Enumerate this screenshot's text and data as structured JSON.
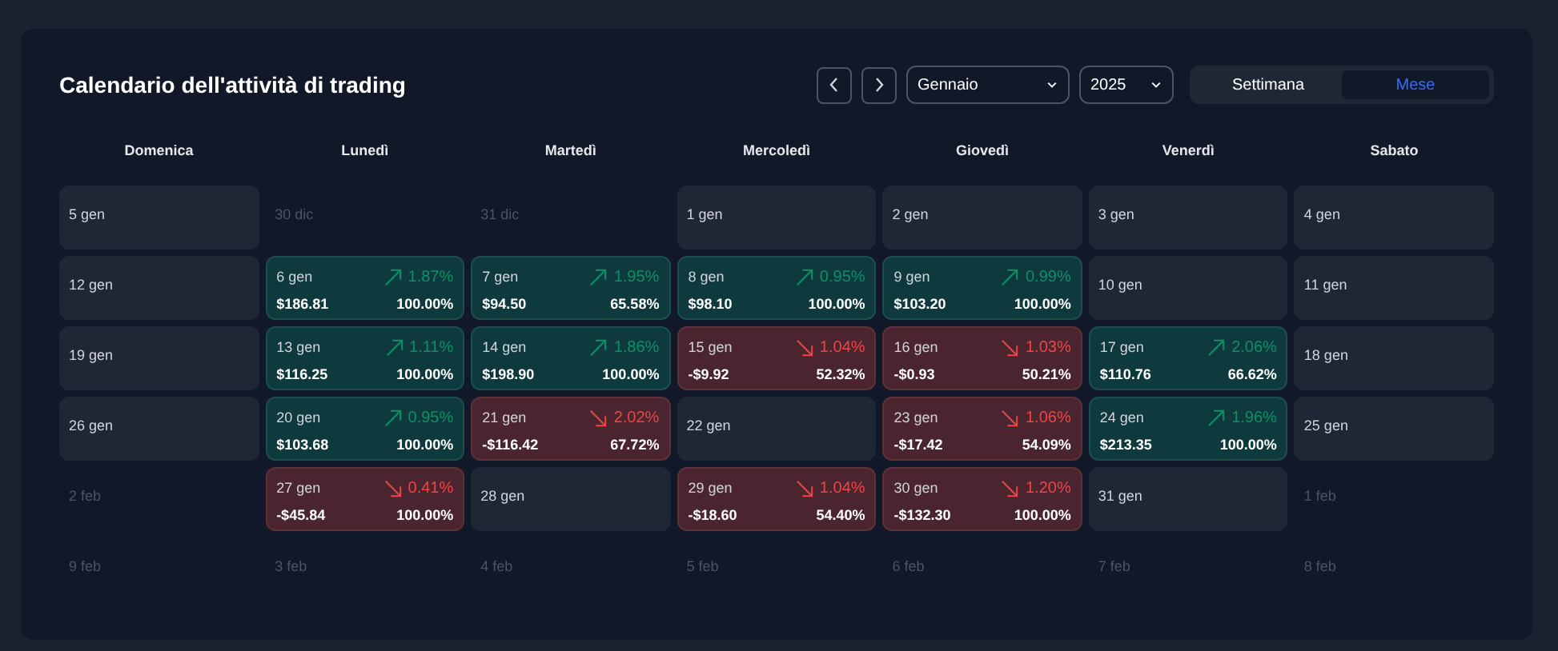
{
  "title": "Calendario dell'attività di trading",
  "month_select": {
    "value": "Gennaio"
  },
  "year_select": {
    "value": "2025"
  },
  "view_toggle": [
    {
      "label": "Settimana",
      "selected": false
    },
    {
      "label": "Mese",
      "selected": true
    }
  ],
  "weekdays": [
    "Domenica",
    "Lunedì",
    "Martedì",
    "Mercoledì",
    "Giovedì",
    "Venerdì",
    "Sabato"
  ],
  "weeks": [
    [
      {
        "kind": "empty",
        "date": "5 gen"
      },
      {
        "kind": "outside",
        "date": "30 dic"
      },
      {
        "kind": "outside",
        "date": "31 dic"
      },
      {
        "kind": "empty",
        "date": "1 gen"
      },
      {
        "kind": "empty",
        "date": "2 gen"
      },
      {
        "kind": "empty",
        "date": "3 gen"
      },
      {
        "kind": "empty",
        "date": "4 gen"
      }
    ],
    [
      {
        "kind": "empty",
        "date": "12 gen"
      },
      {
        "kind": "profit",
        "date": "6 gen",
        "change": "1.87%",
        "amount": "$186.81",
        "win_rate": "100.00%"
      },
      {
        "kind": "profit",
        "date": "7 gen",
        "change": "1.95%",
        "amount": "$94.50",
        "win_rate": "65.58%"
      },
      {
        "kind": "profit",
        "date": "8 gen",
        "change": "0.95%",
        "amount": "$98.10",
        "win_rate": "100.00%"
      },
      {
        "kind": "profit",
        "date": "9 gen",
        "change": "0.99%",
        "amount": "$103.20",
        "win_rate": "100.00%"
      },
      {
        "kind": "empty",
        "date": "10 gen"
      },
      {
        "kind": "empty",
        "date": "11 gen"
      }
    ],
    [
      {
        "kind": "empty",
        "date": "19 gen"
      },
      {
        "kind": "profit",
        "date": "13 gen",
        "change": "1.11%",
        "amount": "$116.25",
        "win_rate": "100.00%"
      },
      {
        "kind": "profit",
        "date": "14 gen",
        "change": "1.86%",
        "amount": "$198.90",
        "win_rate": "100.00%"
      },
      {
        "kind": "loss",
        "date": "15 gen",
        "change": "1.04%",
        "amount": "-$9.92",
        "win_rate": "52.32%"
      },
      {
        "kind": "loss",
        "date": "16 gen",
        "change": "1.03%",
        "amount": "-$0.93",
        "win_rate": "50.21%"
      },
      {
        "kind": "profit",
        "date": "17 gen",
        "change": "2.06%",
        "amount": "$110.76",
        "win_rate": "66.62%"
      },
      {
        "kind": "empty",
        "date": "18 gen"
      }
    ],
    [
      {
        "kind": "empty",
        "date": "26 gen"
      },
      {
        "kind": "profit",
        "date": "20 gen",
        "change": "0.95%",
        "amount": "$103.68",
        "win_rate": "100.00%"
      },
      {
        "kind": "loss",
        "date": "21 gen",
        "change": "2.02%",
        "amount": "-$116.42",
        "win_rate": "67.72%"
      },
      {
        "kind": "empty",
        "date": "22 gen"
      },
      {
        "kind": "loss",
        "date": "23 gen",
        "change": "1.06%",
        "amount": "-$17.42",
        "win_rate": "54.09%"
      },
      {
        "kind": "profit",
        "date": "24 gen",
        "change": "1.96%",
        "amount": "$213.35",
        "win_rate": "100.00%"
      },
      {
        "kind": "empty",
        "date": "25 gen"
      }
    ],
    [
      {
        "kind": "outside",
        "date": "2 feb"
      },
      {
        "kind": "loss",
        "date": "27 gen",
        "change": "0.41%",
        "amount": "-$45.84",
        "win_rate": "100.00%"
      },
      {
        "kind": "empty",
        "date": "28 gen"
      },
      {
        "kind": "loss",
        "date": "29 gen",
        "change": "1.04%",
        "amount": "-$18.60",
        "win_rate": "54.40%"
      },
      {
        "kind": "loss",
        "date": "30 gen",
        "change": "1.20%",
        "amount": "-$132.30",
        "win_rate": "100.00%"
      },
      {
        "kind": "empty",
        "date": "31 gen"
      },
      {
        "kind": "outside",
        "date": "1 feb"
      }
    ],
    [
      {
        "kind": "outside",
        "date": "9 feb"
      },
      {
        "kind": "outside",
        "date": "3 feb"
      },
      {
        "kind": "outside",
        "date": "4 feb"
      },
      {
        "kind": "outside",
        "date": "5 feb"
      },
      {
        "kind": "outside",
        "date": "6 feb"
      },
      {
        "kind": "outside",
        "date": "7 feb"
      },
      {
        "kind": "outside",
        "date": "8 feb"
      }
    ]
  ]
}
